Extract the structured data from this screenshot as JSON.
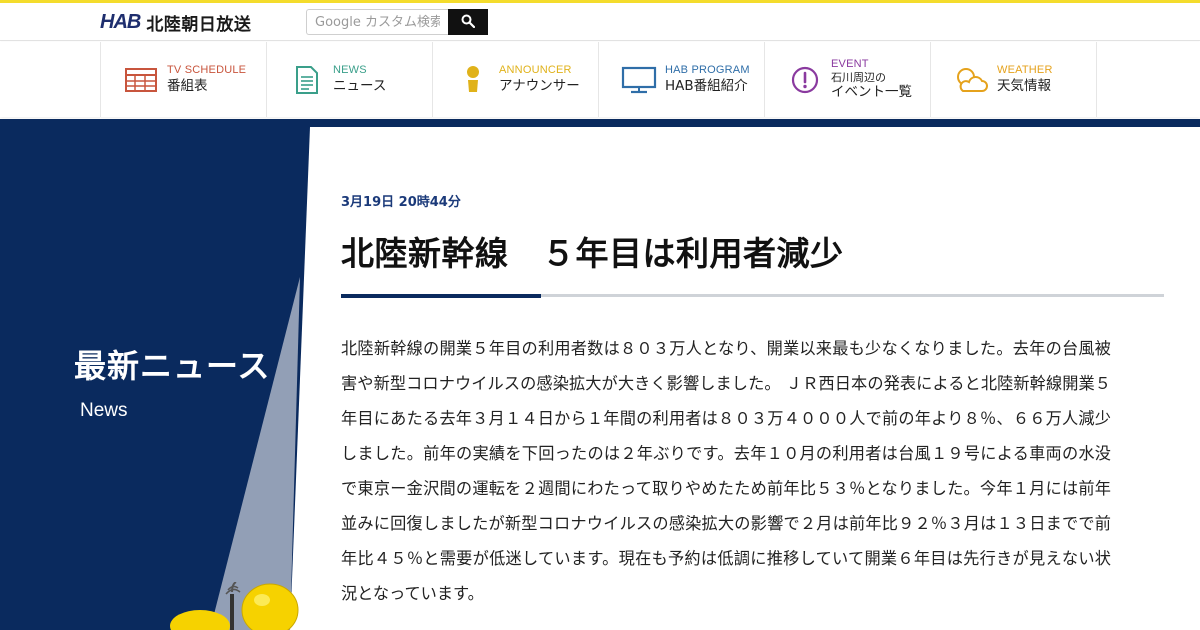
{
  "header": {
    "logo_mark": "HAB",
    "logo_text": "北陸朝日放送",
    "search_placeholder": "Google カスタム検索",
    "search_button_icon": "search-icon"
  },
  "nav": {
    "items": [
      {
        "en": "TV SCHEDULE",
        "ja": "番組表",
        "icon": "tv-schedule-icon",
        "color": "#c8553d"
      },
      {
        "en": "NEWS",
        "ja": "ニュース",
        "icon": "news-document-icon",
        "color": "#3a9f8a"
      },
      {
        "en": "ANNOUNCER",
        "ja": "アナウンサー",
        "icon": "announcer-person-icon",
        "color": "#e0b21a"
      },
      {
        "en": "HAB PROGRAM",
        "ja": "HAB番組紹介",
        "icon": "monitor-icon",
        "color": "#2f6ea8"
      },
      {
        "en": "EVENT",
        "ja_top": "石川周辺の",
        "ja": "イベント一覧",
        "icon": "exclamation-icon",
        "color": "#8a3a9f"
      },
      {
        "en": "WEATHER",
        "ja": "天気情報",
        "icon": "weather-cloud-sun-icon",
        "color": "#e5a21c"
      }
    ]
  },
  "side": {
    "title": "最新ニュース",
    "subtitle": "News"
  },
  "article": {
    "date": "3月19日 20時44分",
    "headline": "北陸新幹線　５年目は利用者減少",
    "body": "北陸新幹線の開業５年目の利用者数は８０３万人となり、開業以来最も少なくなりました。去年の台風被害や新型コロナウイルスの感染拡大が大きく影響しました。 ＪＲ西日本の発表によると北陸新幹線開業５年目にあたる去年３月１４日から１年間の利用者は８０３万４０００人で前の年より８％、６６万人減少しました。前年の実績を下回ったのは２年ぶりです。去年１０月の利用者は台風１９号による車両の水没で東京ー金沢間の運転を２週間にわたって取りやめたため前年比５３％となりました。今年１月には前年並みに回復しましたが新型コロナウイルスの感染拡大の影響で２月は前年比９２％３月は１３日までで前年比４５％と需要が低迷しています。現在も予約は低調に推移していて開業６年目は先行きが見えない状況となっています。"
  },
  "colors": {
    "brand_navy": "#0a2a5e",
    "accent_yellow": "#f4dc2c",
    "date_blue": "#1b3a7a"
  }
}
